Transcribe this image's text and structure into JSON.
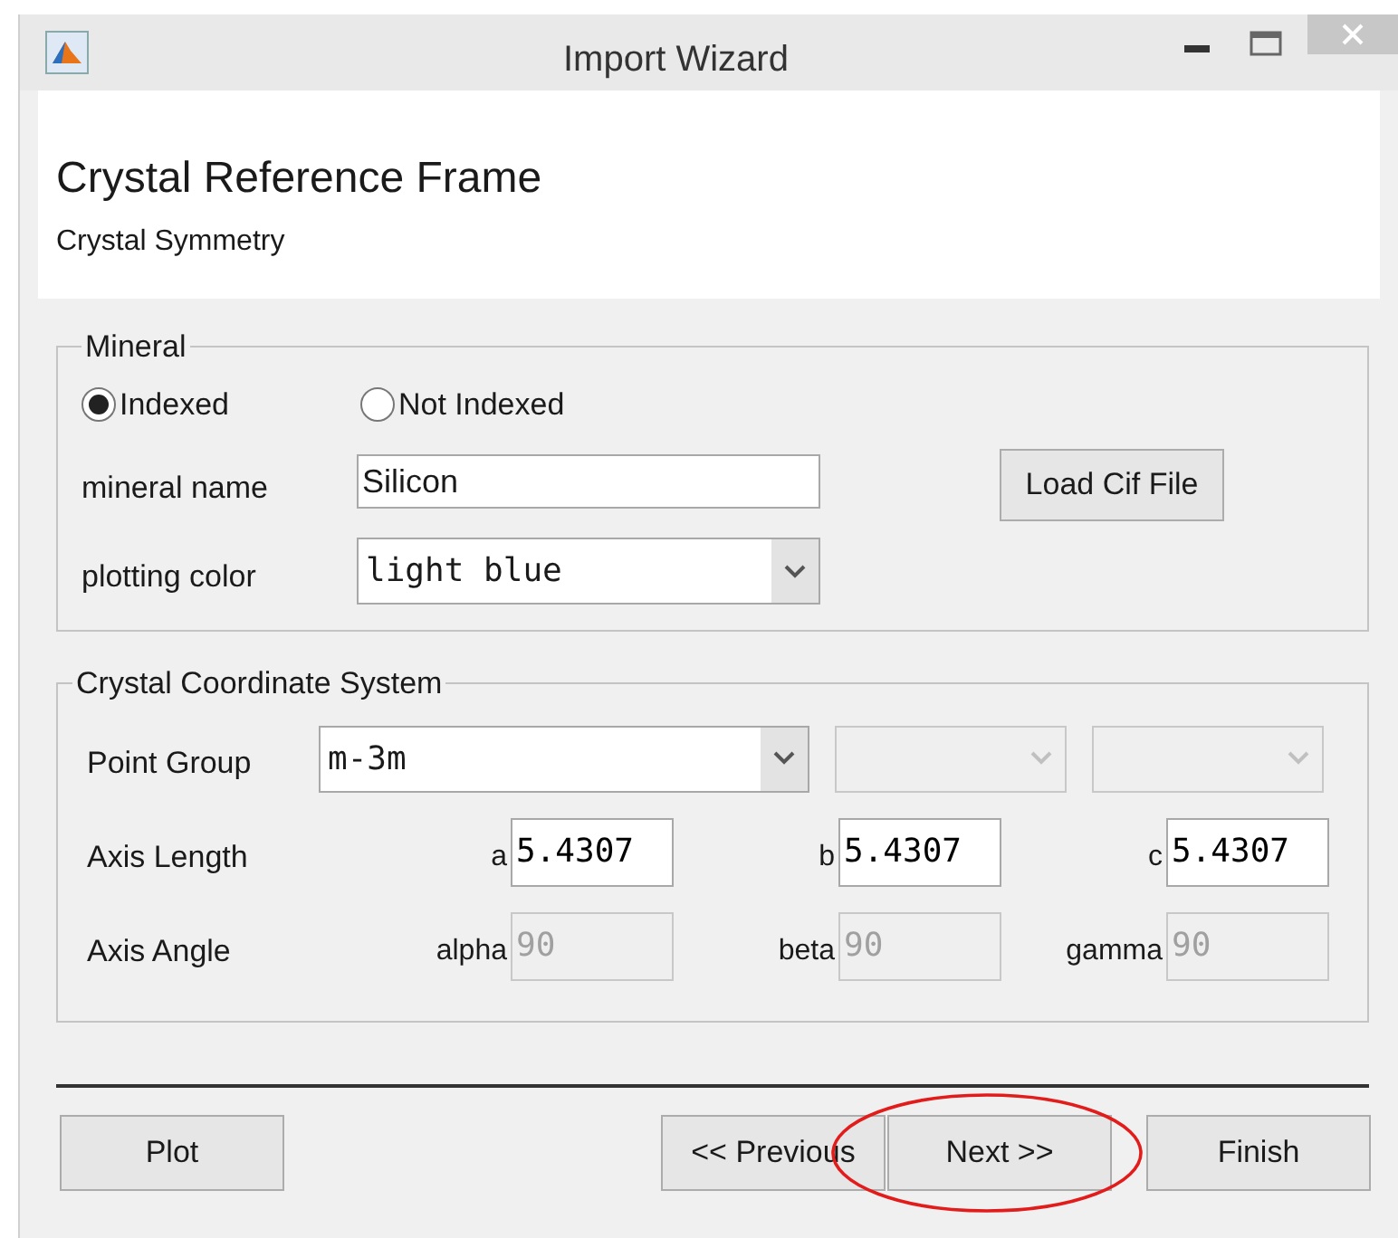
{
  "window": {
    "title": "Import Wizard"
  },
  "header": {
    "title": "Crystal Reference Frame",
    "subtitle": "Crystal Symmetry"
  },
  "mineral": {
    "title": "Mineral",
    "radios": [
      {
        "label": "Indexed",
        "selected": true
      },
      {
        "label": "Not Indexed",
        "selected": false
      }
    ],
    "mineral_name": {
      "label": "mineral name",
      "value": "Silicon"
    },
    "load_button": "Load Cif File",
    "plotting_color": {
      "label": "plotting color",
      "value": "light blue"
    }
  },
  "coordinate_system": {
    "title": "Crystal Coordinate System",
    "point_group": {
      "label": "Point Group",
      "selects": [
        {
          "value": "m-3m",
          "disabled": false
        },
        {
          "disabled": true
        },
        {
          "disabled": true
        }
      ]
    },
    "axis_length": {
      "label": "Axis Length",
      "fields": [
        {
          "label": "a",
          "value": "5.4307",
          "disabled": false
        },
        {
          "label": "b",
          "value": "5.4307",
          "disabled": false
        },
        {
          "label": "c",
          "value": "5.4307",
          "disabled": false
        }
      ]
    },
    "axis_angle": {
      "label": "Axis Angle",
      "fields": [
        {
          "label": "alpha",
          "value": "90",
          "disabled": true
        },
        {
          "label": "beta",
          "value": "90",
          "disabled": true
        },
        {
          "label": "gamma",
          "value": "90",
          "disabled": true
        }
      ]
    }
  },
  "buttons": [
    {
      "label": "Plot",
      "circled": false
    },
    {
      "label": "<< Previous",
      "circled": false
    },
    {
      "label": "Next >>",
      "circled": true
    },
    {
      "label": "Finish",
      "circled": false
    }
  ]
}
